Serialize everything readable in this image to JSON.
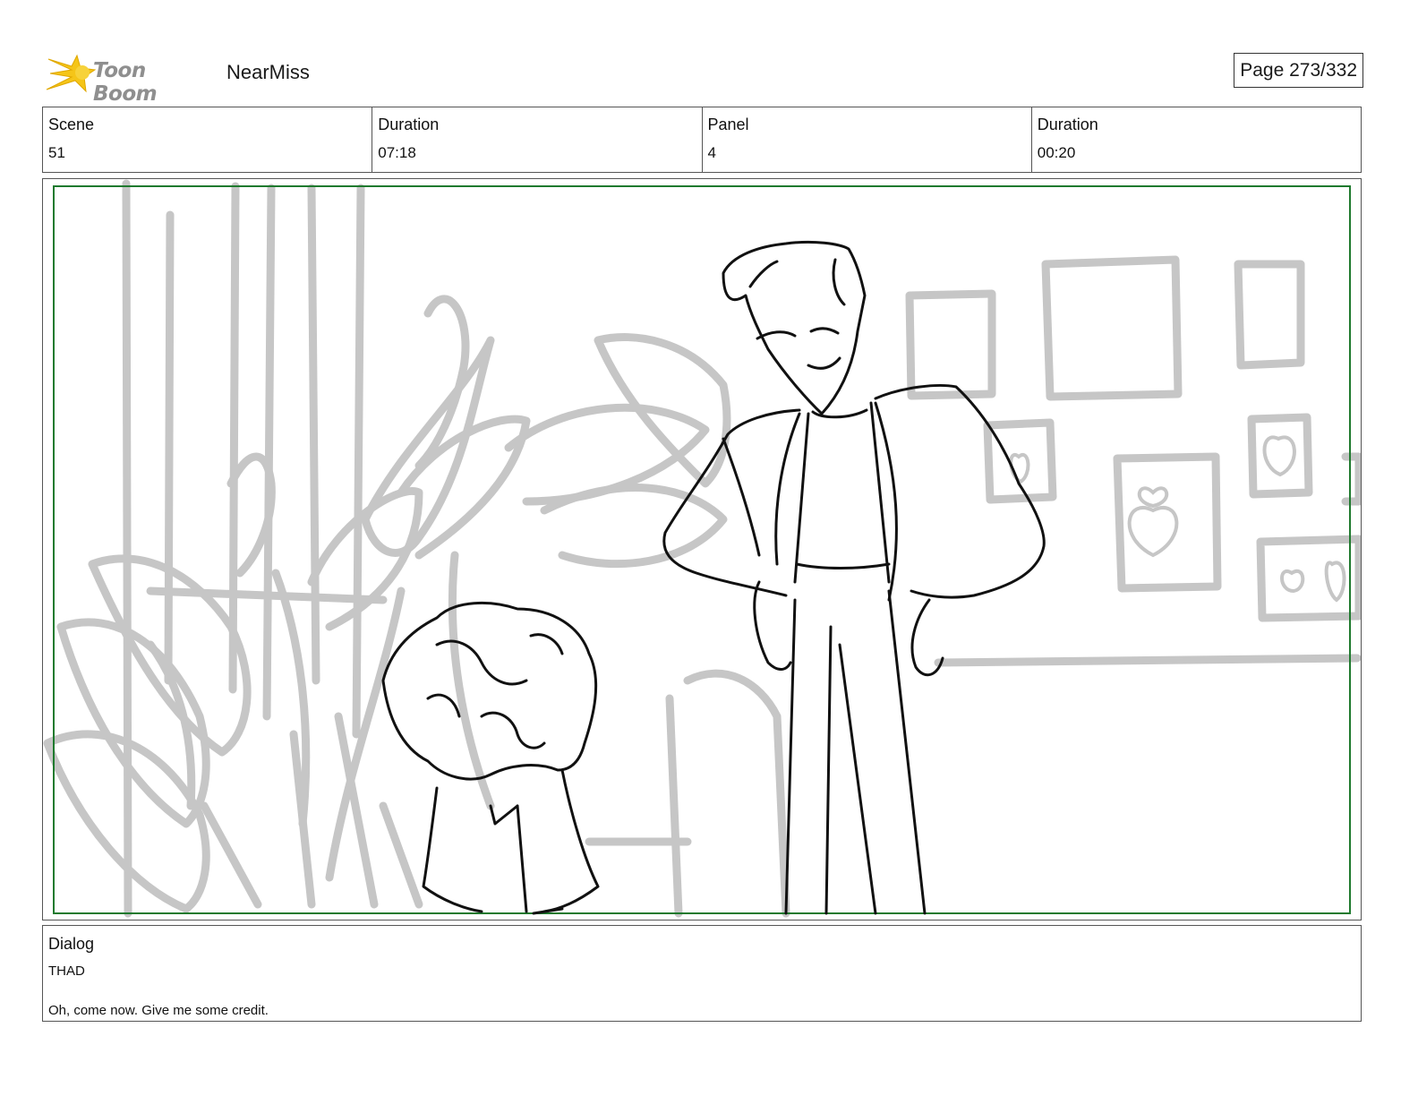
{
  "header": {
    "logo_text": "Toon Boom",
    "project_name": "NearMiss",
    "page_indicator": "Page 273/332"
  },
  "info": {
    "scene_label": "Scene",
    "scene_value": "51",
    "scene_duration_label": "Duration",
    "scene_duration_value": "07:18",
    "panel_label": "Panel",
    "panel_value": "4",
    "panel_duration_label": "Duration",
    "panel_duration_value": "00:20"
  },
  "dialog": {
    "label": "Dialog",
    "speaker": "THAD",
    "line": "Oh, come now. Give me some credit."
  },
  "colors": {
    "safe_frame": "#1f7a2e",
    "background_sketch": "#c6c6c6",
    "character_ink": "#111111",
    "logo_star": "#f5c518"
  }
}
